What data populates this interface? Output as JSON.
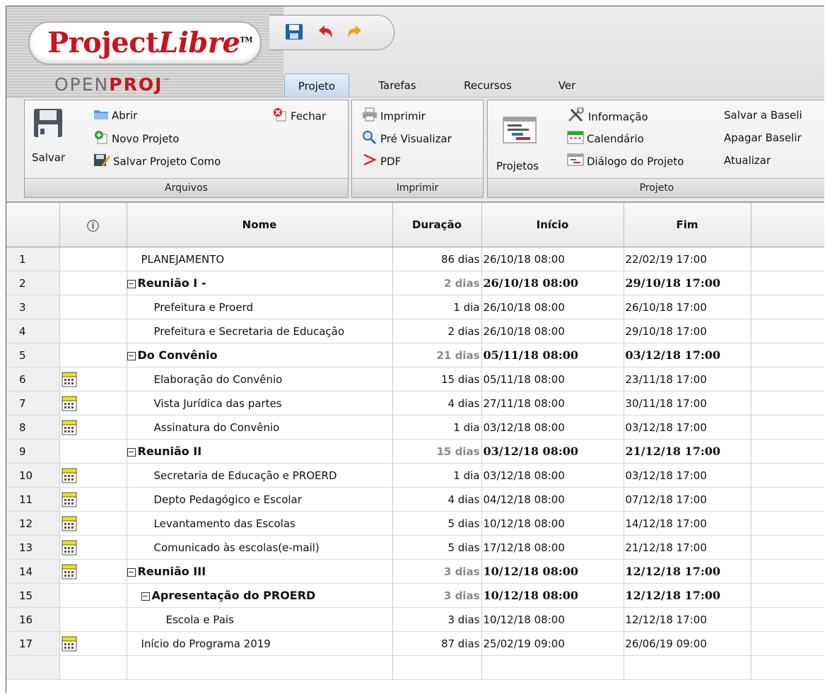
{
  "app": {
    "logo_main": "Project",
    "logo_italic": "Libre",
    "logo_tm": "TM",
    "logo_sub_a": "OPEN",
    "logo_sub_b": "PROJ",
    "logo_sub_tm": "™"
  },
  "quick_access": {
    "icons": [
      "save-icon",
      "undo-icon",
      "redo-icon"
    ]
  },
  "tabs": [
    {
      "label": "Projeto",
      "active": true
    },
    {
      "label": "Tarefas",
      "active": false
    },
    {
      "label": "Recursos",
      "active": false
    },
    {
      "label": "Ver",
      "active": false
    }
  ],
  "ribbon": {
    "arquivos": {
      "label": "Arquivos",
      "salvar": "Salvar",
      "abrir": "Abrir",
      "novo": "Novo Projeto",
      "salvar_como": "Salvar Projeto Como",
      "fechar": "Fechar"
    },
    "imprimir": {
      "label": "Imprimir",
      "imprimir": "Imprimir",
      "pre": "Pré Visualizar",
      "pdf": "PDF"
    },
    "projeto": {
      "label": "Projeto",
      "projetos": "Projetos",
      "informacao": "Informação",
      "calendario": "Calendário",
      "dialogo": "Diálogo do Projeto",
      "salvar_baseline": "Salvar a Baseli",
      "apagar_baseline": "Apagar Baselir",
      "atualizar": "Atualizar"
    }
  },
  "grid": {
    "columns": {
      "info": "ⓘ",
      "nome": "Nome",
      "duracao": "Duração",
      "inicio": "Início",
      "fim": "Fim"
    },
    "rows": [
      {
        "id": "1",
        "name": "PLANEJAMENTO",
        "duration": "86 dias",
        "start": "26/10/18 08:00",
        "end": "22/02/19 17:00",
        "summary": false,
        "level": 0,
        "icon": false
      },
      {
        "id": "2",
        "name": "Reunião I -",
        "duration": "2 dias",
        "start": "26/10/18 08:00",
        "end": "29/10/18 17:00",
        "summary": true,
        "level": 0,
        "icon": false
      },
      {
        "id": "3",
        "name": "Prefeitura e Proerd",
        "duration": "1 dia",
        "start": "26/10/18 08:00",
        "end": "26/10/18 17:00",
        "summary": false,
        "level": 1,
        "icon": false
      },
      {
        "id": "4",
        "name": "Prefeitura e Secretaria de Educação",
        "duration": "2 dias",
        "start": "26/10/18 08:00",
        "end": "29/10/18 17:00",
        "summary": false,
        "level": 1,
        "icon": false
      },
      {
        "id": "5",
        "name": "Do Convênio",
        "duration": "21 dias",
        "start": "05/11/18 08:00",
        "end": "03/12/18 17:00",
        "summary": true,
        "level": 0,
        "icon": false
      },
      {
        "id": "6",
        "name": "Elaboração do Convênio",
        "duration": "15 dias",
        "start": "05/11/18 08:00",
        "end": "23/11/18 17:00",
        "summary": false,
        "level": 1,
        "icon": true
      },
      {
        "id": "7",
        "name": "Vista Jurídica das partes",
        "duration": "4 dias",
        "start": "27/11/18 08:00",
        "end": "30/11/18 17:00",
        "summary": false,
        "level": 1,
        "icon": true
      },
      {
        "id": "8",
        "name": "Assinatura do Convênio",
        "duration": "1 dia",
        "start": "03/12/18 08:00",
        "end": "03/12/18 17:00",
        "summary": false,
        "level": 1,
        "icon": true
      },
      {
        "id": "9",
        "name": "Reunião II",
        "duration": "15 dias",
        "start": "03/12/18 08:00",
        "end": "21/12/18 17:00",
        "summary": true,
        "level": 0,
        "icon": false
      },
      {
        "id": "10",
        "name": "Secretaria de Educação e PROERD",
        "duration": "1 dia",
        "start": "03/12/18 08:00",
        "end": "03/12/18 17:00",
        "summary": false,
        "level": 1,
        "icon": true
      },
      {
        "id": "11",
        "name": "Depto Pedagógico e Escolar",
        "duration": "4 dias",
        "start": "04/12/18 08:00",
        "end": "07/12/18 17:00",
        "summary": false,
        "level": 1,
        "icon": true
      },
      {
        "id": "12",
        "name": "Levantamento das Escolas",
        "duration": "5 dias",
        "start": "10/12/18 08:00",
        "end": "14/12/18 17:00",
        "summary": false,
        "level": 1,
        "icon": true
      },
      {
        "id": "13",
        "name": "Comunicado às escolas(e-mail)",
        "duration": "5 dias",
        "start": "17/12/18 08:00",
        "end": "21/12/18 17:00",
        "summary": false,
        "level": 1,
        "icon": true
      },
      {
        "id": "14",
        "name": "Reunião III",
        "duration": "3 dias",
        "start": "10/12/18 08:00",
        "end": "12/12/18 17:00",
        "summary": true,
        "level": 0,
        "icon": true
      },
      {
        "id": "15",
        "name": "Apresentação do PROERD",
        "duration": "3 dias",
        "start": "10/12/18 08:00",
        "end": "12/12/18 17:00",
        "summary": true,
        "level": 1,
        "icon": false
      },
      {
        "id": "16",
        "name": "Escola e Pais",
        "duration": "3 dias",
        "start": "10/12/18 08:00",
        "end": "12/12/18 17:00",
        "summary": false,
        "level": 2,
        "icon": false
      },
      {
        "id": "17",
        "name": "Início do Programa 2019",
        "duration": "87 dias",
        "start": "25/02/19 09:00",
        "end": "26/06/19 09:00",
        "summary": false,
        "level": 0,
        "icon": true
      }
    ]
  }
}
